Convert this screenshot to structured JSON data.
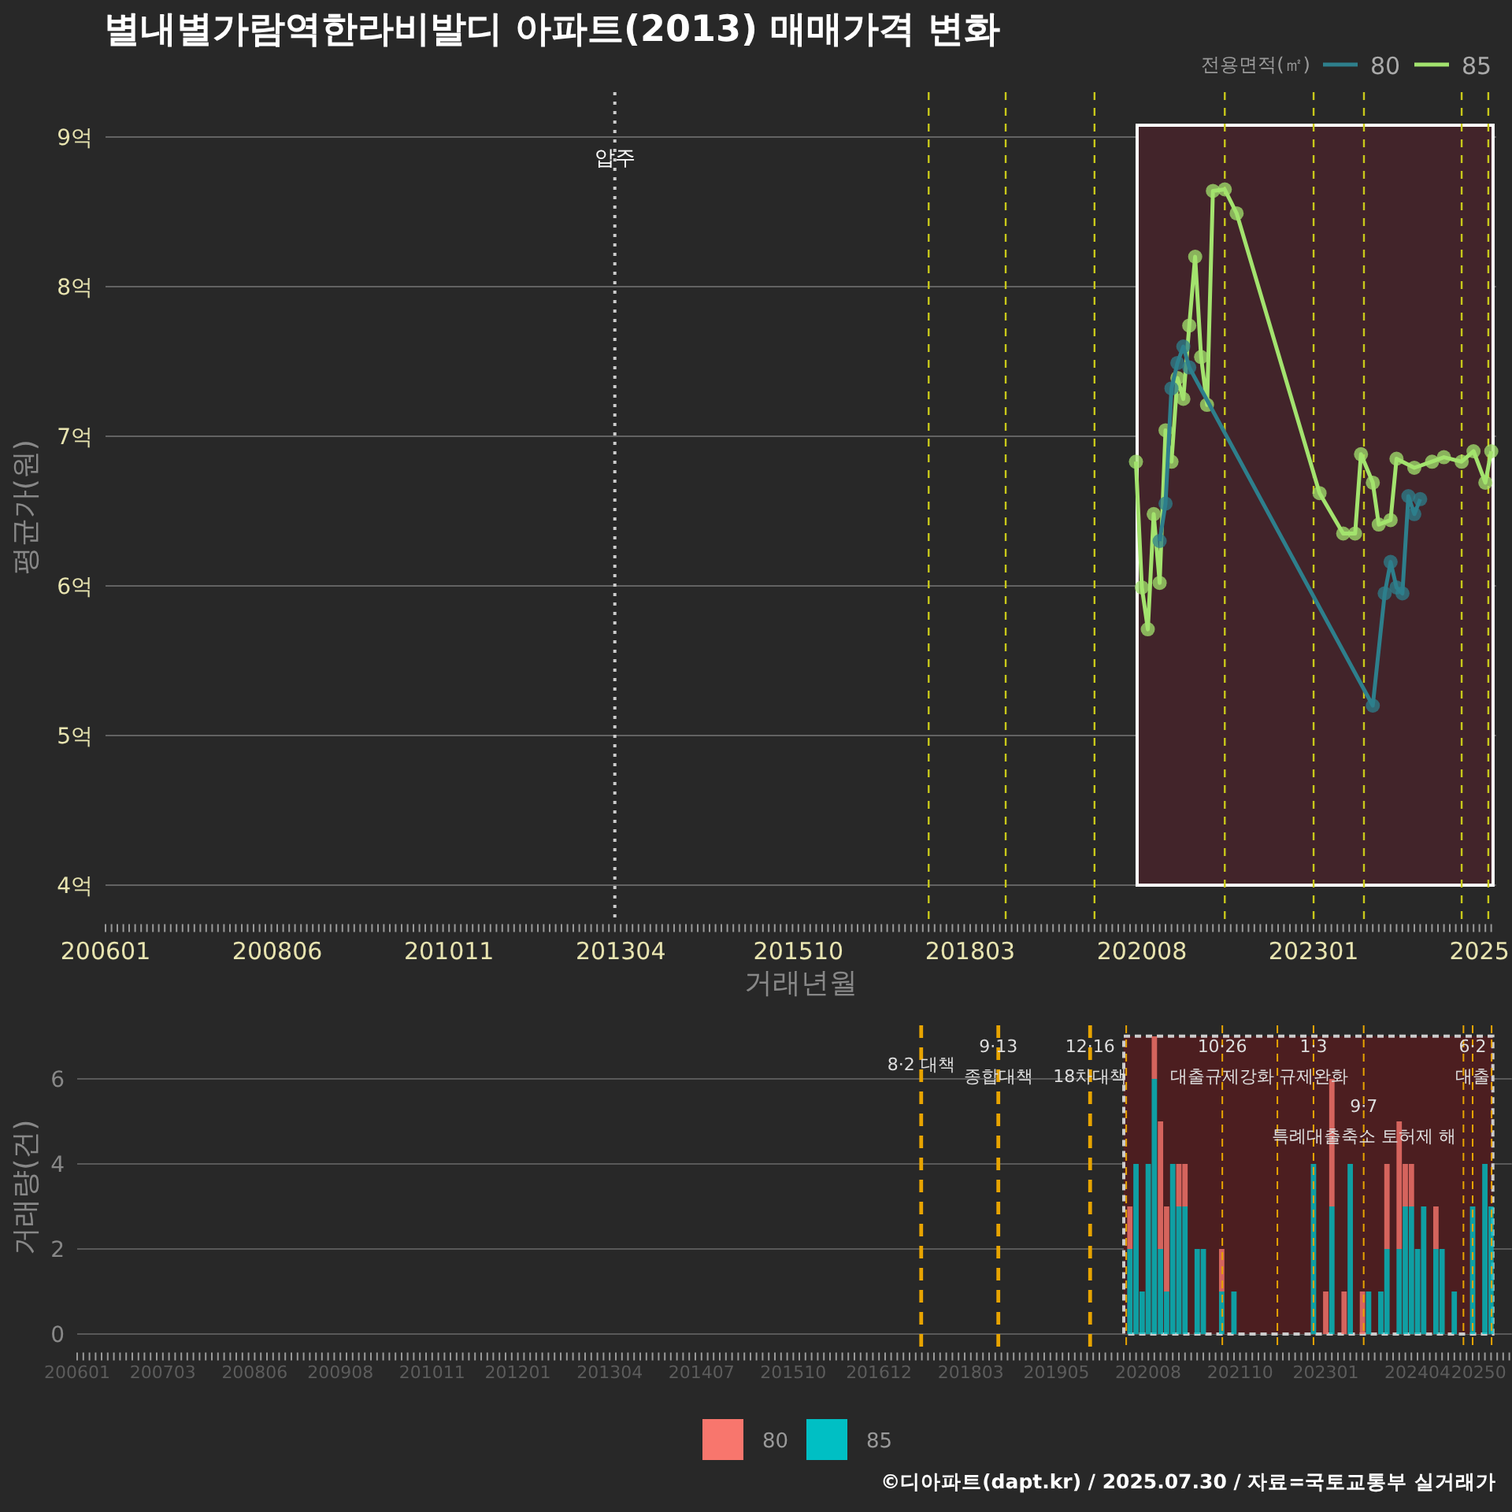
{
  "title": "별내별가람역한라비발디 아파트(2013) 매매가격 변화",
  "price_panel": {
    "legend_title": "전용면적(㎡)",
    "chart_data": {
      "type": "line",
      "legend": "top-right",
      "xlabel": "거래년월",
      "ylabel": "평균가(원)",
      "ylim": [
        3.75,
        9.3
      ],
      "categories": [
        "200601",
        null,
        null,
        null,
        null,
        null,
        null,
        null,
        null,
        null,
        null,
        null,
        null,
        null,
        null,
        null,
        null,
        null,
        null,
        null,
        null,
        null,
        null,
        null,
        null,
        null,
        null,
        null,
        null,
        "200806",
        null,
        null,
        null,
        null,
        null,
        null,
        null,
        null,
        null,
        null,
        null,
        null,
        null,
        null,
        null,
        null,
        null,
        null,
        null,
        null,
        null,
        null,
        null,
        null,
        null,
        null,
        null,
        null,
        "201011",
        null,
        null,
        null,
        null,
        null,
        null,
        null,
        null,
        null,
        null,
        null,
        null,
        null,
        null,
        null,
        null,
        null,
        null,
        null,
        null,
        null,
        null,
        null,
        null,
        null,
        null,
        null,
        null,
        "201304",
        null,
        null,
        null,
        null,
        null,
        null,
        null,
        null,
        null,
        null,
        null,
        null,
        null,
        null,
        null,
        null,
        null,
        null,
        null,
        null,
        null,
        null,
        null,
        null,
        null,
        null,
        null,
        null,
        null,
        "201510",
        null,
        null,
        null,
        null,
        null,
        null,
        null,
        null,
        null,
        null,
        null,
        null,
        null,
        null,
        null,
        null,
        null,
        null,
        null,
        null,
        null,
        null,
        null,
        null,
        null,
        null,
        null,
        null,
        "201803",
        null,
        null,
        null,
        null,
        null,
        null,
        null,
        null,
        null,
        null,
        null,
        null,
        null,
        null,
        null,
        null,
        null,
        null,
        null,
        null,
        null,
        null,
        null,
        null,
        null,
        null,
        null,
        null,
        "202008",
        null,
        null,
        null,
        null,
        null,
        null,
        null,
        null,
        null,
        null,
        null,
        null,
        null,
        null,
        null,
        null,
        null,
        null,
        null,
        null,
        null,
        null,
        null,
        null,
        null,
        null,
        null,
        null,
        "202301",
        null,
        null,
        null,
        null,
        null,
        null,
        null,
        null,
        null,
        null,
        null,
        null,
        null,
        null,
        null,
        null,
        null,
        null,
        null,
        null,
        null,
        null,
        null,
        null,
        null,
        null,
        null,
        "2025",
        null,
        null
      ],
      "yticks": [
        {
          "value": 4,
          "label": "4억"
        },
        {
          "value": 5,
          "label": "5억"
        },
        {
          "value": 6,
          "label": "6억"
        },
        {
          "value": 7,
          "label": "7억"
        },
        {
          "value": 8,
          "label": "8억"
        },
        {
          "value": 9,
          "label": "9억"
        }
      ],
      "series": [
        {
          "name": "80",
          "color": "#2e7f8c",
          "marker": "circle",
          "values": [
            null,
            null,
            null,
            null,
            null,
            null,
            null,
            null,
            null,
            null,
            null,
            null,
            null,
            null,
            null,
            null,
            null,
            null,
            null,
            null,
            null,
            null,
            null,
            null,
            null,
            null,
            null,
            null,
            null,
            null,
            null,
            null,
            null,
            null,
            null,
            null,
            null,
            null,
            null,
            null,
            null,
            null,
            null,
            null,
            null,
            null,
            null,
            null,
            null,
            null,
            null,
            null,
            null,
            null,
            null,
            null,
            null,
            null,
            null,
            null,
            null,
            null,
            null,
            null,
            null,
            null,
            null,
            null,
            null,
            null,
            null,
            null,
            null,
            null,
            null,
            null,
            null,
            null,
            null,
            null,
            null,
            null,
            null,
            null,
            null,
            null,
            null,
            null,
            null,
            null,
            null,
            null,
            null,
            null,
            null,
            null,
            null,
            null,
            null,
            null,
            null,
            null,
            null,
            null,
            null,
            null,
            null,
            null,
            null,
            null,
            null,
            null,
            null,
            null,
            null,
            null,
            null,
            null,
            null,
            null,
            null,
            null,
            null,
            null,
            null,
            null,
            null,
            null,
            null,
            null,
            null,
            null,
            null,
            null,
            null,
            null,
            null,
            null,
            null,
            null,
            null,
            null,
            null,
            null,
            null,
            null,
            null,
            null,
            null,
            null,
            null,
            null,
            null,
            null,
            null,
            null,
            null,
            null,
            null,
            null,
            null,
            null,
            null,
            null,
            null,
            null,
            null,
            null,
            null,
            null,
            null,
            null,
            null,
            null,
            null,
            null,
            null,
            null,
            6.3,
            6.55,
            7.32,
            7.49,
            7.6,
            7.46,
            null,
            null,
            null,
            null,
            null,
            null,
            null,
            null,
            null,
            null,
            null,
            null,
            null,
            null,
            null,
            null,
            null,
            null,
            null,
            null,
            null,
            null,
            null,
            null,
            null,
            null,
            null,
            null,
            null,
            null,
            5.2,
            null,
            5.95,
            6.16,
            5.99,
            5.95,
            6.6,
            6.48,
            6.58,
            null,
            null,
            null,
            null,
            null,
            null,
            null,
            null,
            null,
            null,
            null,
            null
          ]
        },
        {
          "name": "85",
          "color": "#a3e36e",
          "marker": "circle",
          "values": [
            null,
            null,
            null,
            null,
            null,
            null,
            null,
            null,
            null,
            null,
            null,
            null,
            null,
            null,
            null,
            null,
            null,
            null,
            null,
            null,
            null,
            null,
            null,
            null,
            null,
            null,
            null,
            null,
            null,
            null,
            null,
            null,
            null,
            null,
            null,
            null,
            null,
            null,
            null,
            null,
            null,
            null,
            null,
            null,
            null,
            null,
            null,
            null,
            null,
            null,
            null,
            null,
            null,
            null,
            null,
            null,
            null,
            null,
            null,
            null,
            null,
            null,
            null,
            null,
            null,
            null,
            null,
            null,
            null,
            null,
            null,
            null,
            null,
            null,
            null,
            null,
            null,
            null,
            null,
            null,
            null,
            null,
            null,
            null,
            null,
            null,
            null,
            null,
            null,
            null,
            null,
            null,
            null,
            null,
            null,
            null,
            null,
            null,
            null,
            null,
            null,
            null,
            null,
            null,
            null,
            null,
            null,
            null,
            null,
            null,
            null,
            null,
            null,
            null,
            null,
            null,
            null,
            null,
            null,
            null,
            null,
            null,
            null,
            null,
            null,
            null,
            null,
            null,
            null,
            null,
            null,
            null,
            null,
            null,
            null,
            null,
            null,
            null,
            null,
            null,
            null,
            null,
            null,
            null,
            null,
            null,
            null,
            null,
            null,
            null,
            null,
            null,
            null,
            null,
            null,
            null,
            null,
            null,
            null,
            null,
            null,
            null,
            null,
            null,
            null,
            null,
            null,
            null,
            null,
            null,
            null,
            null,
            null,
            null,
            6.83,
            5.99,
            5.71,
            6.48,
            6.02,
            7.04,
            6.83,
            7.39,
            7.25,
            7.74,
            8.2,
            7.53,
            7.21,
            8.64,
            null,
            8.65,
            null,
            8.49,
            null,
            null,
            null,
            null,
            null,
            null,
            null,
            null,
            null,
            null,
            null,
            null,
            null,
            6.62,
            null,
            null,
            null,
            6.35,
            null,
            6.35,
            6.88,
            null,
            6.69,
            6.41,
            null,
            6.44,
            6.85,
            null,
            null,
            6.79,
            null,
            null,
            6.83,
            null,
            6.86,
            null,
            null,
            6.83,
            null,
            6.9,
            null,
            6.69,
            6.9
          ]
        }
      ],
      "grid": true
    },
    "line_labels": [
      "압주"
    ]
  },
  "volume_panel": {
    "chart_data": {
      "type": "bar",
      "legend": "bottom",
      "stacked": true,
      "ylabel": "거래량(건)",
      "ylim": [
        -0.4,
        7.3
      ],
      "categories": [
        "200601",
        null,
        null,
        null,
        null,
        null,
        null,
        null,
        null,
        null,
        null,
        null,
        null,
        null,
        "200703",
        null,
        null,
        null,
        null,
        null,
        null,
        null,
        null,
        null,
        null,
        null,
        null,
        null,
        null,
        "200806",
        null,
        null,
        null,
        null,
        null,
        null,
        null,
        null,
        null,
        null,
        null,
        null,
        null,
        "200908",
        null,
        null,
        null,
        null,
        null,
        null,
        null,
        null,
        null,
        null,
        null,
        null,
        null,
        null,
        "201011",
        null,
        null,
        null,
        null,
        null,
        null,
        null,
        null,
        null,
        null,
        null,
        null,
        null,
        "201201",
        null,
        null,
        null,
        null,
        null,
        null,
        null,
        null,
        null,
        null,
        null,
        null,
        null,
        null,
        "201304",
        null,
        null,
        null,
        null,
        null,
        null,
        null,
        null,
        null,
        null,
        null,
        null,
        null,
        null,
        "201407",
        null,
        null,
        null,
        null,
        null,
        null,
        null,
        null,
        null,
        null,
        null,
        null,
        null,
        null,
        "201510",
        null,
        null,
        null,
        null,
        null,
        null,
        null,
        null,
        null,
        null,
        null,
        null,
        null,
        "201612",
        null,
        null,
        null,
        null,
        null,
        null,
        null,
        null,
        null,
        null,
        null,
        null,
        null,
        null,
        "201803",
        null,
        null,
        null,
        null,
        null,
        null,
        null,
        null,
        null,
        null,
        null,
        null,
        null,
        "201905",
        null,
        null,
        null,
        null,
        null,
        null,
        null,
        null,
        null,
        null,
        null,
        null,
        null,
        null,
        "202008",
        null,
        null,
        null,
        null,
        null,
        null,
        null,
        null,
        null,
        null,
        null,
        null,
        null,
        null,
        "202110",
        null,
        null,
        null,
        null,
        null,
        null,
        null,
        null,
        null,
        null,
        null,
        null,
        null,
        "202301",
        null,
        null,
        null,
        null,
        null,
        null,
        null,
        null,
        null,
        null,
        null,
        null,
        null,
        null,
        "202404",
        null,
        null,
        null,
        null,
        null,
        null,
        null,
        null,
        null,
        "20250",
        null,
        null,
        null,
        null,
        null
      ],
      "yticks": [
        0,
        2,
        4,
        6
      ],
      "series": [
        {
          "name": "80",
          "color": "#f8766d",
          "values": [
            null,
            null,
            null,
            null,
            null,
            null,
            null,
            null,
            null,
            null,
            null,
            null,
            null,
            null,
            null,
            null,
            null,
            null,
            null,
            null,
            null,
            null,
            null,
            null,
            null,
            null,
            null,
            null,
            null,
            null,
            null,
            null,
            null,
            null,
            null,
            null,
            null,
            null,
            null,
            null,
            null,
            null,
            null,
            null,
            null,
            null,
            null,
            null,
            null,
            null,
            null,
            null,
            null,
            null,
            null,
            null,
            null,
            null,
            null,
            null,
            null,
            null,
            null,
            null,
            null,
            null,
            null,
            null,
            null,
            null,
            null,
            null,
            null,
            null,
            null,
            null,
            null,
            null,
            null,
            null,
            null,
            null,
            null,
            null,
            null,
            null,
            null,
            null,
            null,
            null,
            null,
            null,
            null,
            null,
            null,
            null,
            null,
            null,
            null,
            null,
            null,
            null,
            null,
            null,
            null,
            null,
            null,
            null,
            null,
            null,
            null,
            null,
            null,
            null,
            null,
            null,
            null,
            null,
            null,
            null,
            null,
            null,
            null,
            null,
            null,
            null,
            null,
            null,
            null,
            null,
            null,
            null,
            null,
            null,
            null,
            null,
            null,
            null,
            null,
            null,
            null,
            null,
            null,
            null,
            null,
            null,
            null,
            null,
            null,
            null,
            null,
            null,
            null,
            null,
            null,
            null,
            null,
            null,
            null,
            null,
            null,
            null,
            null,
            null,
            null,
            null,
            null,
            null,
            null,
            null,
            null,
            null,
            1,
            0,
            0,
            0,
            1,
            3,
            2,
            0,
            1,
            1,
            null,
            0,
            0,
            null,
            null,
            1,
            null,
            0,
            null,
            null,
            null,
            null,
            null,
            null,
            null,
            null,
            null,
            null,
            null,
            null,
            0,
            null,
            1,
            3,
            null,
            1,
            0,
            null,
            1,
            0,
            null,
            0,
            2,
            null,
            3,
            1,
            1,
            0,
            0,
            null,
            1,
            0,
            null,
            0,
            null,
            null,
            0,
            null,
            0,
            0,
            null,
            null,
            null
          ]
        },
        {
          "name": "85",
          "color": "#00bfc4",
          "values": [
            null,
            null,
            null,
            null,
            null,
            null,
            null,
            null,
            null,
            null,
            null,
            null,
            null,
            null,
            null,
            null,
            null,
            null,
            null,
            null,
            null,
            null,
            null,
            null,
            null,
            null,
            null,
            null,
            null,
            null,
            null,
            null,
            null,
            null,
            null,
            null,
            null,
            null,
            null,
            null,
            null,
            null,
            null,
            null,
            null,
            null,
            null,
            null,
            null,
            null,
            null,
            null,
            null,
            null,
            null,
            null,
            null,
            null,
            null,
            null,
            null,
            null,
            null,
            null,
            null,
            null,
            null,
            null,
            null,
            null,
            null,
            null,
            null,
            null,
            null,
            null,
            null,
            null,
            null,
            null,
            null,
            null,
            null,
            null,
            null,
            null,
            null,
            null,
            null,
            null,
            null,
            null,
            null,
            null,
            null,
            null,
            null,
            null,
            null,
            null,
            null,
            null,
            null,
            null,
            null,
            null,
            null,
            null,
            null,
            null,
            null,
            null,
            null,
            null,
            null,
            null,
            null,
            null,
            null,
            null,
            null,
            null,
            null,
            null,
            null,
            null,
            null,
            null,
            null,
            null,
            null,
            null,
            null,
            null,
            null,
            null,
            null,
            null,
            null,
            null,
            null,
            null,
            null,
            null,
            null,
            null,
            null,
            null,
            null,
            null,
            null,
            null,
            null,
            null,
            null,
            null,
            null,
            null,
            null,
            null,
            null,
            null,
            null,
            null,
            null,
            null,
            null,
            null,
            null,
            null,
            null,
            null,
            2,
            4,
            1,
            4,
            6,
            2,
            1,
            4,
            3,
            3,
            null,
            2,
            2,
            null,
            null,
            1,
            null,
            1,
            null,
            null,
            null,
            null,
            null,
            null,
            null,
            null,
            null,
            null,
            null,
            null,
            4,
            null,
            0,
            3,
            null,
            0,
            4,
            null,
            0,
            1,
            null,
            1,
            2,
            null,
            2,
            3,
            3,
            2,
            3,
            null,
            2,
            2,
            null,
            1,
            null,
            null,
            3,
            null,
            4,
            3,
            null,
            null,
            null
          ]
        }
      ],
      "grid": true
    },
    "policy_labels": [
      "8·2 대책",
      "9·13\n종합대책",
      "12·16\n18차대책",
      "10·26\n대출규제강화",
      "1·3\n규제완화",
      "9·7\n특례대출축소 토허제 해",
      "6·2\n대출"
    ]
  },
  "footer": "©디아파트(dapt.kr) / 2025.07.30 / 자료=국토교통부 실거래가"
}
